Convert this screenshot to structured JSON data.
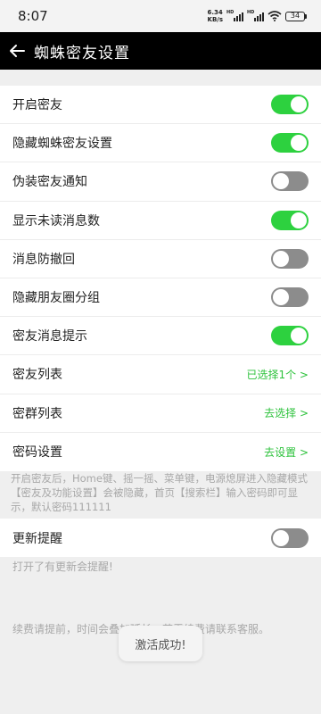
{
  "status_bar": {
    "time": "8:07",
    "net_speed_value": "6.34",
    "net_speed_unit": "KB/s",
    "signal_label": "HD",
    "battery": "34"
  },
  "title_bar": {
    "title": "蜘蛛密友设置",
    "back_icon": "arrow-left-icon"
  },
  "settings": {
    "toggles": [
      {
        "label": "开启密友",
        "on": true
      },
      {
        "label": "隐藏蜘蛛密友设置",
        "on": true
      },
      {
        "label": "伪装密友通知",
        "on": false
      },
      {
        "label": "显示未读消息数",
        "on": true
      },
      {
        "label": "消息防撤回",
        "on": false
      },
      {
        "label": "隐藏朋友圈分组",
        "on": false
      },
      {
        "label": "密友消息提示",
        "on": true
      }
    ],
    "links": [
      {
        "label": "密友列表",
        "value": "已选择1个 >"
      },
      {
        "label": "密群列表",
        "value": "去选择 >"
      },
      {
        "label": "密码设置",
        "value": "去设置 >"
      }
    ]
  },
  "hint": "开启密友后，Home键、摇一摇、菜单键，电源熄屏进入隐藏模式【密友及功能设置】会被隐藏，首页【搜索栏】输入密码即可显示，默认密码111111",
  "update": {
    "label": "更新提醒",
    "on": false,
    "hint": "打开了有更新会提醒!"
  },
  "renew_hint": "续费请提前，时间会叠加延长，若需续费请联系客服。",
  "toast": "激活成功!",
  "colors": {
    "toggle_on": "#2dd13f",
    "toggle_off": "#8c8c8c",
    "link": "#2dc23c",
    "title_bar": "#000000"
  }
}
